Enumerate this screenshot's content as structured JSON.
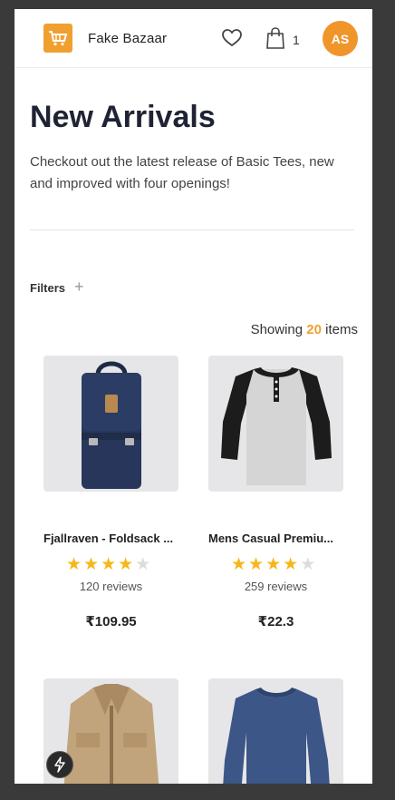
{
  "header": {
    "brand": "Fake Bazaar",
    "cart_count": "1",
    "avatar_initials": "AS"
  },
  "page": {
    "title": "New Arrivals",
    "subtitle": "Checkout out the latest release of Basic Tees, new and improved with four openings!",
    "filters_label": "Filters",
    "showing_prefix": "Showing",
    "showing_count": "20",
    "showing_suffix": "items"
  },
  "products": [
    {
      "name": "Fjallraven - Foldsack ...",
      "rating": 4,
      "reviews": "120 reviews",
      "price": "₹109.95"
    },
    {
      "name": "Mens Casual Premiu...",
      "rating": 4,
      "reviews": "259 reviews",
      "price": "₹22.3"
    }
  ],
  "colors": {
    "accent": "#f0a030",
    "star": "#f6b818"
  }
}
